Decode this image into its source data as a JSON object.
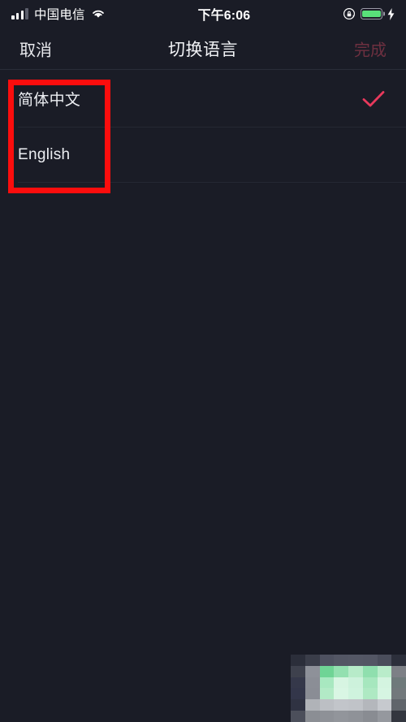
{
  "status_bar": {
    "carrier": "中国电信",
    "time": "下午6:06",
    "signal_bars_filled": 3,
    "signal_bars_total": 4,
    "wifi_icon": "wifi-icon",
    "rotation_lock_icon": "rotation-lock-icon",
    "battery_icon": "battery-icon",
    "battery_color": "#59e07a",
    "charging_icon": "lightning-bolt-icon"
  },
  "nav_bar": {
    "cancel_label": "取消",
    "title": "切换语言",
    "done_label": "完成",
    "done_color": "#6e3040",
    "cancel_color": "#e9eaee"
  },
  "language_list": {
    "rows": [
      {
        "label": "简体中文",
        "selected": true,
        "check_icon": "checkmark-icon"
      },
      {
        "label": "English",
        "selected": false,
        "check_icon": ""
      }
    ]
  },
  "annotation": {
    "type": "highlight-rectangle",
    "color": "#fb0d0d"
  },
  "mosaic": {
    "type": "pixelated-censor-block",
    "tiles": [
      "#2b2e3a",
      "#3a3d49",
      "#4e5160",
      "#535664",
      "#545765",
      "#535664",
      "#4a4d5b",
      "#2c2f3b",
      "#3e414d",
      "#8e9199",
      "#6fd495",
      "#93e0b0",
      "#b7ebc9",
      "#8fdfae",
      "#b9ecca",
      "#7d8086",
      "#35384a",
      "#8b8e96",
      "#a8e8c0",
      "#d7f5e2",
      "#cdf2dc",
      "#a6e7be",
      "#d4f4e0",
      "#6f7a7b",
      "#33364a",
      "#8a8d95",
      "#b2eac6",
      "#d9f6e4",
      "#cff3de",
      "#aee9c3",
      "#d6f5e2",
      "#72797c",
      "#2f3242",
      "#b0b3b8",
      "#bcbfc4",
      "#c2c5ca",
      "#c0c3c8",
      "#b4b7bc",
      "#c6c9ce",
      "#60656b",
      "#4c4f5b",
      "#8b8e94",
      "#8e9197",
      "#92959b",
      "#8f9298",
      "#898c92",
      "#95989e",
      "#33363f"
    ]
  }
}
